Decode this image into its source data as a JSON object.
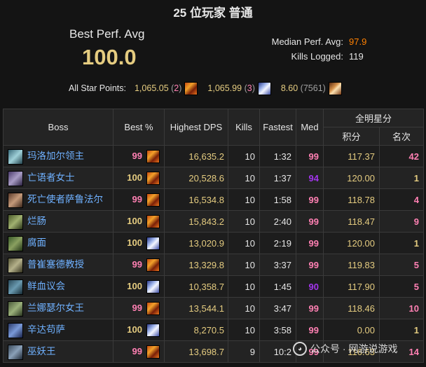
{
  "header": {
    "title": "25 位玩家 普通",
    "best_perf_label": "Best Perf. Avg",
    "best_perf_value": "100.0",
    "median_label": "Median Perf. Avg:",
    "median_value": "97.9",
    "kills_label": "Kills Logged:",
    "kills_value": "119",
    "all_star_label": "All Star Points:",
    "all_star": [
      {
        "points": "1,065.05",
        "rank": "2",
        "icon": "fire-spec-icon"
      },
      {
        "points": "1,065.99",
        "rank": "3",
        "icon": "frost-spec-icon"
      },
      {
        "points": "8.60",
        "rank": "7561",
        "icon": "arcane-spec-icon"
      }
    ]
  },
  "table": {
    "headers": {
      "boss": "Boss",
      "best": "Best %",
      "dps": "Highest DPS",
      "kills": "Kills",
      "fastest": "Fastest",
      "med": "Med",
      "allstar_group": "全明星分",
      "points": "积分",
      "rank": "名次"
    },
    "rows": [
      {
        "boss": "玛洛加尔领主",
        "best": "99",
        "spec": "fire",
        "dps": "16,635.2",
        "kills": "10",
        "fastest": "1:32",
        "med": "99",
        "points": "117.37",
        "rank": "42"
      },
      {
        "boss": "亡语者女士",
        "best": "100",
        "spec": "fire",
        "dps": "20,528.6",
        "kills": "10",
        "fastest": "1:37",
        "med": "94",
        "points": "120.00",
        "rank": "1"
      },
      {
        "boss": "死亡使者萨鲁法尔",
        "best": "99",
        "spec": "fire",
        "dps": "16,534.8",
        "kills": "10",
        "fastest": "1:58",
        "med": "99",
        "points": "118.78",
        "rank": "4"
      },
      {
        "boss": "烂肠",
        "best": "100",
        "spec": "fire",
        "dps": "15,843.2",
        "kills": "10",
        "fastest": "2:40",
        "med": "99",
        "points": "118.47",
        "rank": "9"
      },
      {
        "boss": "腐面",
        "best": "100",
        "spec": "frost",
        "dps": "13,020.9",
        "kills": "10",
        "fastest": "2:19",
        "med": "99",
        "points": "120.00",
        "rank": "1"
      },
      {
        "boss": "普崔塞德教授",
        "best": "99",
        "spec": "fire",
        "dps": "13,329.8",
        "kills": "10",
        "fastest": "3:37",
        "med": "99",
        "points": "119.83",
        "rank": "5"
      },
      {
        "boss": "鲜血议会",
        "best": "100",
        "spec": "frost",
        "dps": "10,358.7",
        "kills": "10",
        "fastest": "1:45",
        "med": "90",
        "points": "117.90",
        "rank": "5"
      },
      {
        "boss": "兰娜瑟尔女王",
        "best": "99",
        "spec": "fire",
        "dps": "13,544.1",
        "kills": "10",
        "fastest": "3:47",
        "med": "99",
        "points": "118.46",
        "rank": "10"
      },
      {
        "boss": "辛达苟萨",
        "best": "100",
        "spec": "frost",
        "dps": "8,270.5",
        "kills": "10",
        "fastest": "3:58",
        "med": "99",
        "points": "0.00",
        "rank": "1"
      },
      {
        "boss": "巫妖王",
        "best": "99",
        "spec": "fire",
        "dps": "13,698.7",
        "kills": "9",
        "fastest": "10:2",
        "med": "99",
        "points": "116.63",
        "rank": "14"
      }
    ]
  },
  "watermark": {
    "text": "公众号 · 网游说游戏",
    "icon": "wechat-icon"
  },
  "colors": {
    "gold": "#e5cc80",
    "pink": "#ff80b3",
    "purple": "#a335ee",
    "orange": "#ff8000",
    "boss_blue": "#6fb1ff",
    "background": "#141414"
  }
}
